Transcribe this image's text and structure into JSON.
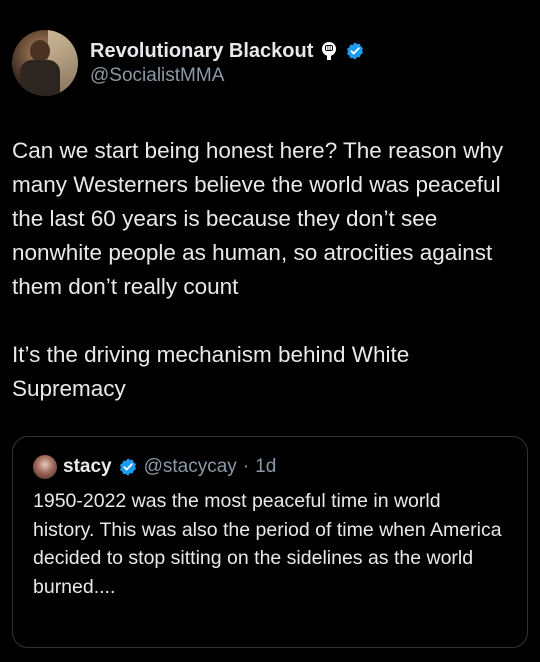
{
  "tweet": {
    "display_name": "Revolutionary Blackout",
    "handle": "@SocialistMMA",
    "paragraphs": [
      "Can we start being honest here? The reason why many Westerners believe the world was peaceful the last 60 years is because they don’t see nonwhite people as human, so atrocities against them don’t really count",
      "It’s the driving mechanism behind White Supremacy"
    ]
  },
  "quote": {
    "display_name": "stacy",
    "handle": "@stacycay",
    "separator": "·",
    "time": "1d",
    "text": "1950-2022 was the most peaceful time in world history. This was also the period of time when America decided to stop sitting on the sidelines as the world burned...."
  },
  "colors": {
    "background": "#000000",
    "text": "#e7e9ea",
    "secondary": "#8b98a5",
    "verified_blue": "#1d9bf0",
    "border": "#2f3336"
  },
  "icons": {
    "name_badge": "raised-fist-icon",
    "verified": "verified-badge-icon"
  }
}
